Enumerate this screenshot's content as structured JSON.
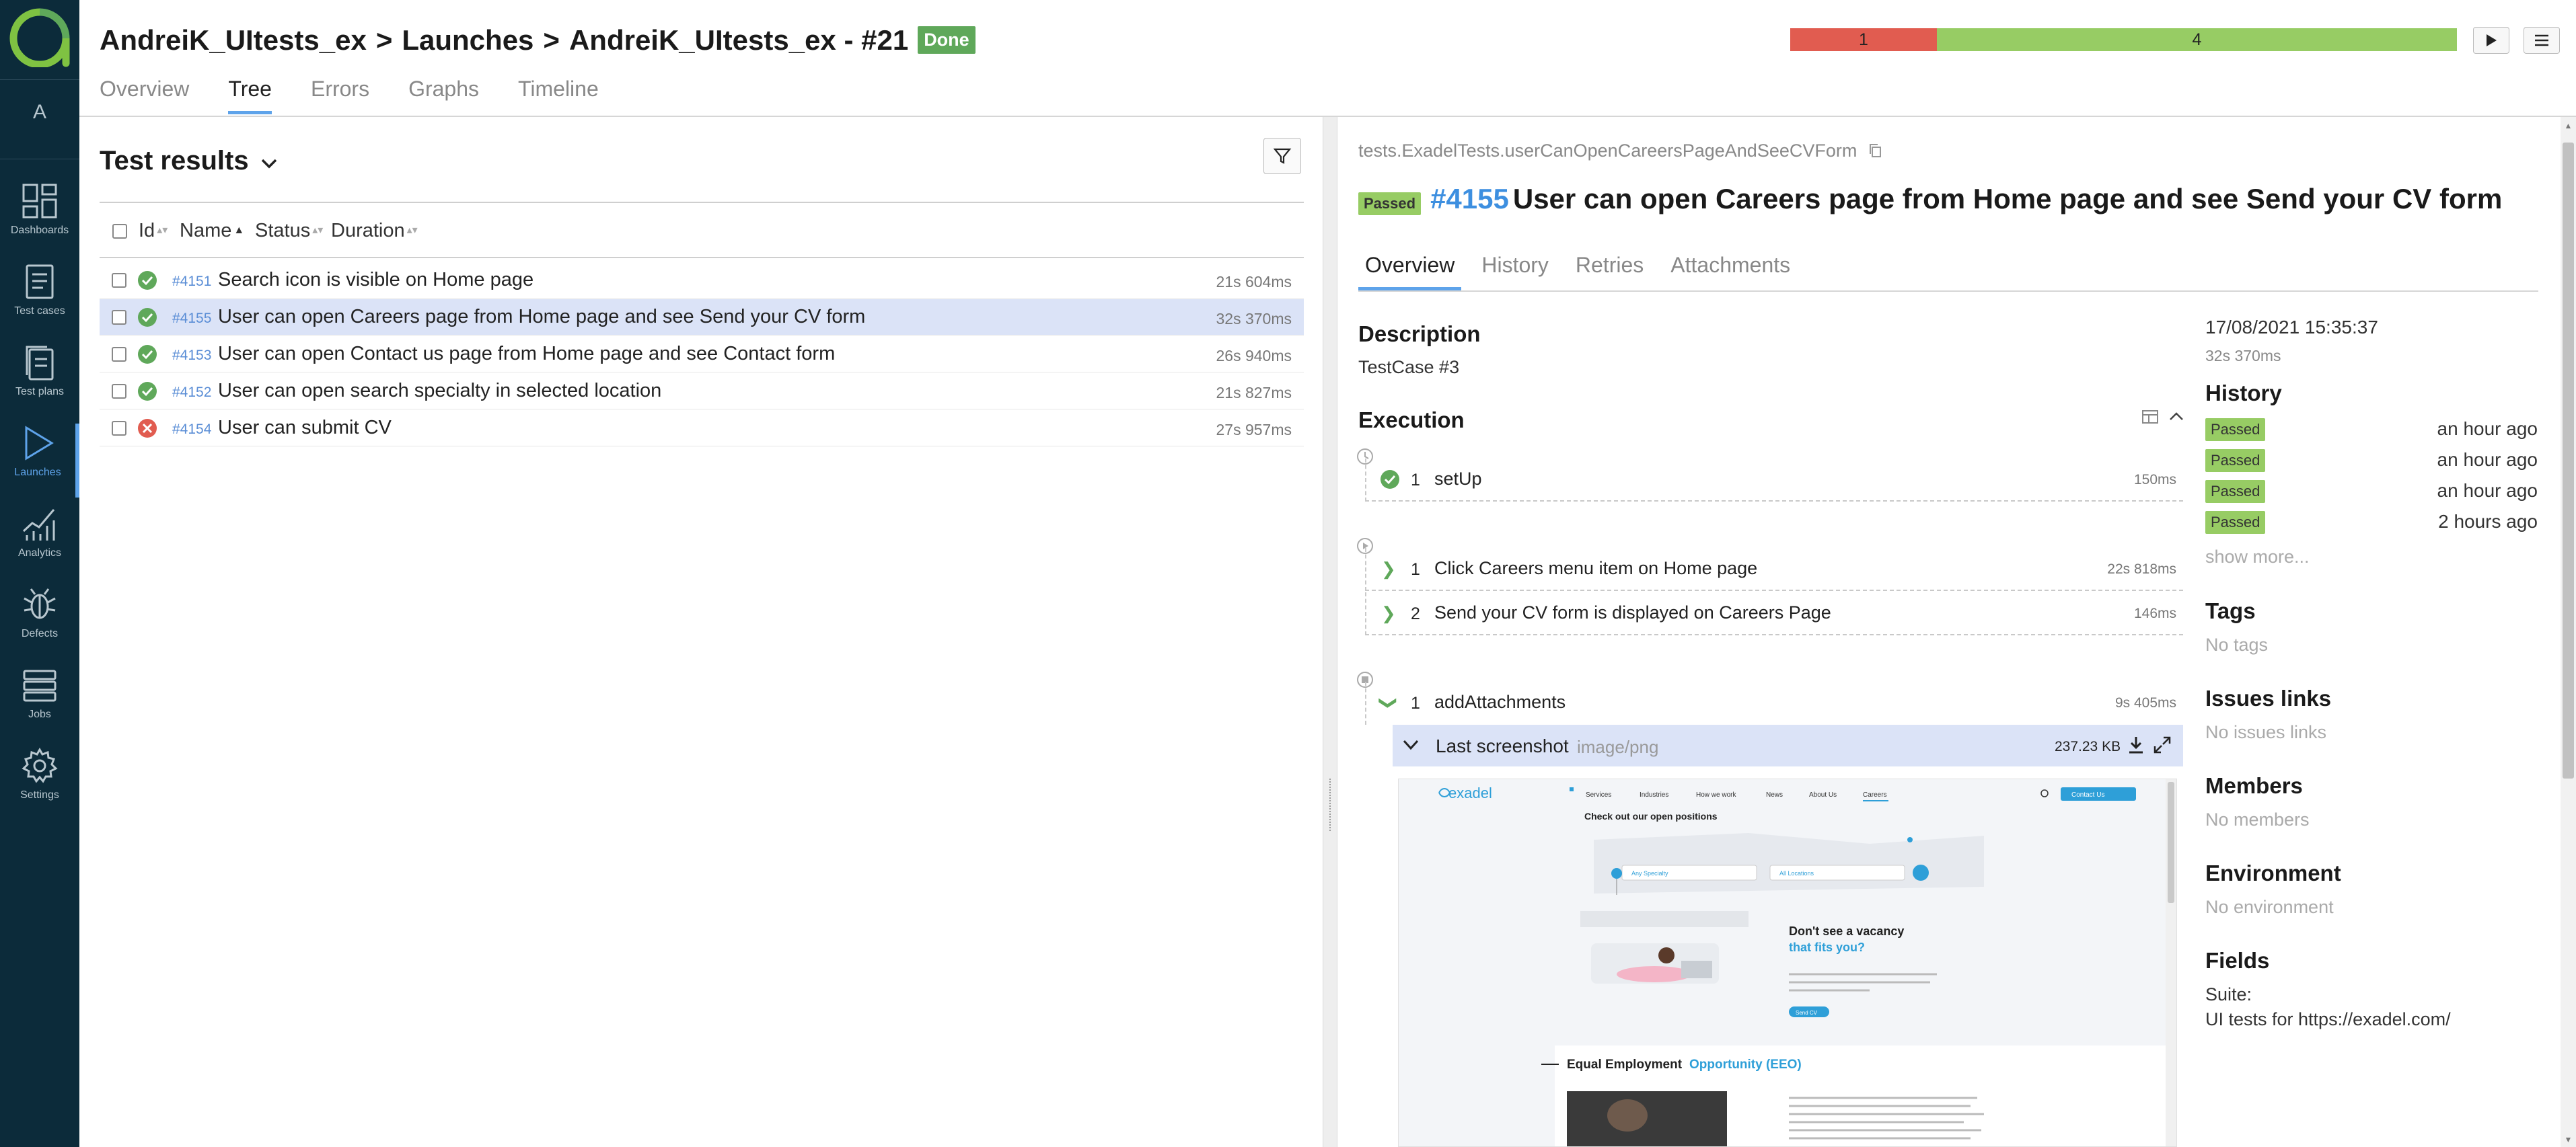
{
  "header": {
    "breadcrumb": [
      "AndreiK_UItests_ex",
      "Launches",
      "AndreiK_UItests_ex - #21"
    ],
    "separator": ">",
    "status_badge": "Done",
    "stats": [
      {
        "label": "1",
        "fraction": 0.22,
        "color": "#e15c50"
      },
      {
        "label": "4",
        "fraction": 0.78,
        "color": "#97cc64"
      }
    ],
    "tabs": [
      {
        "label": "Overview",
        "active": false
      },
      {
        "label": "Tree",
        "active": true
      },
      {
        "label": "Errors",
        "active": false
      },
      {
        "label": "Graphs",
        "active": false
      },
      {
        "label": "Timeline",
        "active": false
      }
    ],
    "play_icon": "play-icon",
    "menu_icon": "menu-icon"
  },
  "sidebar": {
    "avatar": "A",
    "items": [
      {
        "label": "Dashboards",
        "icon": "dashboards-icon",
        "active": false
      },
      {
        "label": "Test cases",
        "icon": "test-cases-icon",
        "active": false
      },
      {
        "label": "Test plans",
        "icon": "test-plans-icon",
        "active": false
      },
      {
        "label": "Launches",
        "icon": "launches-icon",
        "active": true
      },
      {
        "label": "Analytics",
        "icon": "analytics-icon",
        "active": false
      },
      {
        "label": "Defects",
        "icon": "bug-icon",
        "active": false
      },
      {
        "label": "Jobs",
        "icon": "jobs-icon",
        "active": false
      },
      {
        "label": "Settings",
        "icon": "gear-icon",
        "active": false
      }
    ]
  },
  "results": {
    "title": "Test results",
    "columns": [
      "Id",
      "Name",
      "Status",
      "Duration"
    ],
    "rows": [
      {
        "id": "#4151",
        "name": "Search icon is visible on Home page",
        "duration": "21s 604ms",
        "status": "passed",
        "selected": false
      },
      {
        "id": "#4155",
        "name": "User can open Careers page from Home page and see Send your CV form",
        "duration": "32s 370ms",
        "status": "passed",
        "selected": true
      },
      {
        "id": "#4153",
        "name": "User can open Contact us page from Home page and see Contact form",
        "duration": "26s 940ms",
        "status": "passed",
        "selected": false
      },
      {
        "id": "#4152",
        "name": "User can open search specialty in selected location",
        "duration": "21s 827ms",
        "status": "passed",
        "selected": false
      },
      {
        "id": "#4154",
        "name": "User can submit CV",
        "duration": "27s 957ms",
        "status": "failed",
        "selected": false
      }
    ]
  },
  "detail": {
    "full_name": "tests.ExadelTests.userCanOpenCareersPageAndSeeCVForm",
    "status": "Passed",
    "id": "#4155",
    "title": "User can open Careers page from Home page and see Send your CV form",
    "tabs": [
      "Overview",
      "History",
      "Retries",
      "Attachments"
    ],
    "description_h": "Description",
    "description": "TestCase #3",
    "execution_h": "Execution",
    "setup": [
      {
        "n": "1",
        "name": "setUp",
        "duration": "150ms"
      }
    ],
    "body": [
      {
        "n": "1",
        "name": "Click Careers menu item on Home page",
        "duration": "22s 818ms"
      },
      {
        "n": "2",
        "name": "Send your CV form is displayed on Careers Page",
        "duration": "146ms"
      }
    ],
    "teardown": [
      {
        "n": "1",
        "name": "addAttachments",
        "duration": "9s 405ms"
      }
    ],
    "attachment": {
      "name": "Last screenshot",
      "type": "image/png",
      "size": "237.23 KB"
    },
    "screenshot": {
      "nav": [
        "Services",
        "Industries",
        "How we work",
        "News",
        "About Us",
        "Careers"
      ],
      "contact": "Contact Us",
      "heading": "Check out our open positions",
      "specialty": "Any Specialty",
      "location": "All Locations",
      "vacancy_1": "Don't see a vacancy",
      "vacancy_2": "that fits you?",
      "send_btn": "Send CV",
      "eeo_a": "Equal Employment",
      "eeo_b": "Opportunity (EEO)"
    }
  },
  "side": {
    "date": "17/08/2021 15:35:37",
    "duration": "32s 370ms",
    "history_h": "History",
    "history": [
      {
        "status": "Passed",
        "time": "an hour ago"
      },
      {
        "status": "Passed",
        "time": "an hour ago"
      },
      {
        "status": "Passed",
        "time": "an hour ago"
      },
      {
        "status": "Passed",
        "time": "2 hours ago"
      }
    ],
    "show_more": "show more...",
    "tags_h": "Tags",
    "tags": "No tags",
    "issues_h": "Issues links",
    "issues": "No issues links",
    "members_h": "Members",
    "members": "No members",
    "env_h": "Environment",
    "env": "No environment",
    "fields_h": "Fields",
    "suite_label": "Suite:",
    "suite": "UI tests for https://exadel.com/"
  }
}
